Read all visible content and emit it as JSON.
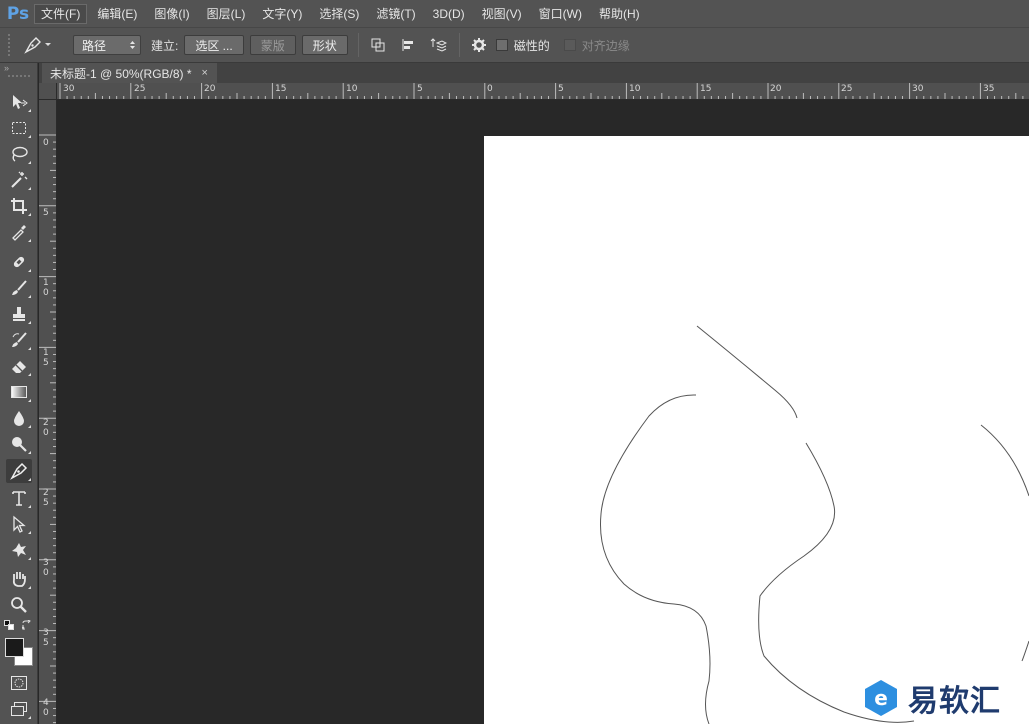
{
  "app": {
    "logo": "Ps"
  },
  "menu": [
    {
      "label": "文件(F)",
      "active": true
    },
    {
      "label": "编辑(E)"
    },
    {
      "label": "图像(I)"
    },
    {
      "label": "图层(L)"
    },
    {
      "label": "文字(Y)"
    },
    {
      "label": "选择(S)"
    },
    {
      "label": "滤镜(T)"
    },
    {
      "label": "3D(D)"
    },
    {
      "label": "视图(V)"
    },
    {
      "label": "窗口(W)"
    },
    {
      "label": "帮助(H)"
    }
  ],
  "options": {
    "mode": "路径",
    "make_label": "建立:",
    "selection_btn": "选区 ...",
    "mask_btn": "蒙版",
    "shape_btn": "形状",
    "magnetic_label": "磁性的",
    "align_edges_label": "对齐边缘"
  },
  "document": {
    "tab_title": "未标题-1 @ 50%(RGB/8) *",
    "close": "×"
  },
  "ruler": {
    "h_labels": [
      "30",
      "25",
      "20",
      "15",
      "10",
      "5",
      "0",
      "5",
      "10",
      "15",
      "20",
      "25",
      "30",
      "35"
    ],
    "v_labels": [
      "0",
      "5",
      "10",
      "15",
      "20",
      "25",
      "30",
      "35",
      "40"
    ]
  },
  "icons": {
    "move": "move-icon",
    "marquee": "rect-marquee-icon",
    "lasso": "lasso-icon",
    "magic": "magic-wand-icon",
    "crop": "crop-icon",
    "eyedropper": "eyedropper-icon",
    "heal": "healing-brush-icon",
    "brush": "brush-icon",
    "stamp": "clone-stamp-icon",
    "history": "history-brush-icon",
    "eraser": "eraser-icon",
    "gradient": "gradient-icon",
    "blur": "blur-icon",
    "dodge": "dodge-icon",
    "pen": "pen-icon",
    "type": "type-icon",
    "path_select": "path-selection-icon",
    "shape": "custom-shape-icon",
    "hand": "hand-icon",
    "zoom": "zoom-icon"
  },
  "colors": {
    "foreground": "#1a1a1a",
    "background": "#ffffff",
    "accent": "#5fa3e6"
  },
  "watermark": {
    "text": "易软汇"
  }
}
